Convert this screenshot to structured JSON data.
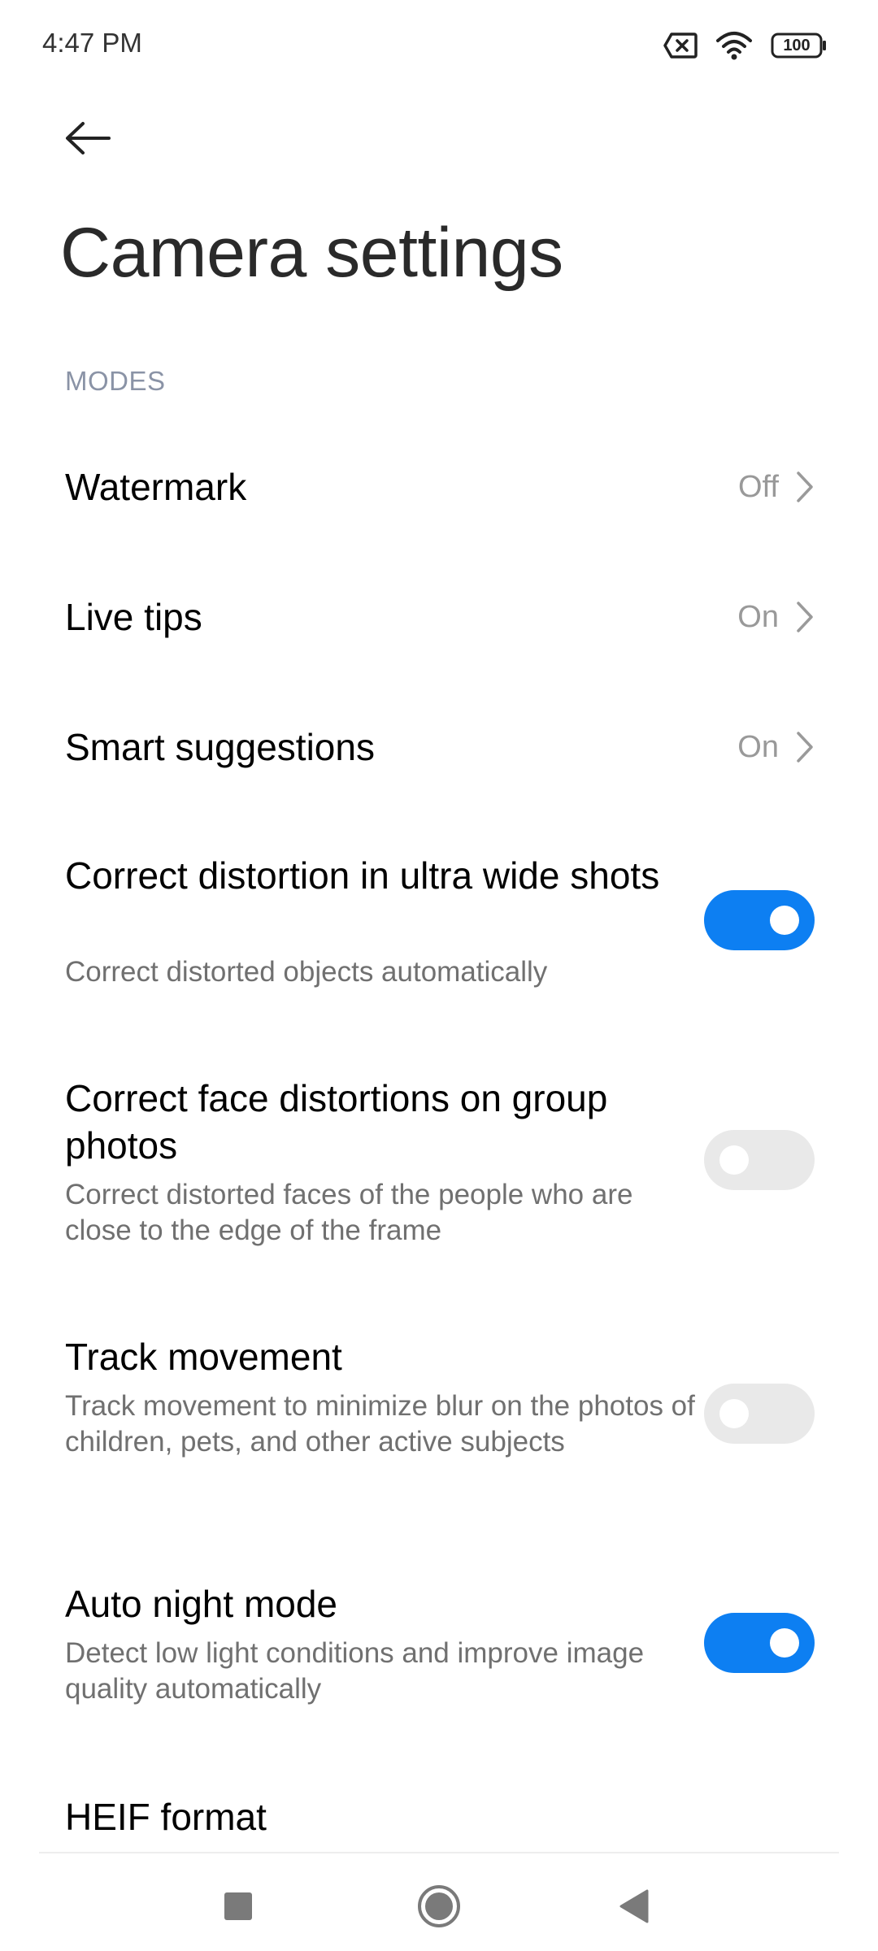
{
  "status_bar": {
    "time": "4:47 PM",
    "battery": "100"
  },
  "header": {
    "title": "Camera settings"
  },
  "section": {
    "modes": "MODES"
  },
  "nav_rows": [
    {
      "title": "Watermark",
      "value": "Off"
    },
    {
      "title": "Live tips",
      "value": "On"
    },
    {
      "title": "Smart suggestions",
      "value": "On"
    }
  ],
  "toggles": [
    {
      "title": "Correct distortion in ultra wide shots",
      "subtitle": "Correct distorted objects automatically",
      "on": true
    },
    {
      "title": "Correct face distortions on group photos",
      "subtitle": "Correct distorted faces of the people who are close to the edge of the frame",
      "on": false
    },
    {
      "title": "Track movement",
      "subtitle": "Track movement to minimize blur on the photos of children, pets, and other active subjects",
      "on": false
    },
    {
      "title": "Auto night mode",
      "subtitle": "Detect low light conditions and improve image quality automatically",
      "on": true
    }
  ],
  "partial_row": {
    "title": "HEIF format"
  },
  "colors": {
    "accent": "#0d7ff2",
    "toggle_off": "#e9e9e9",
    "section_header": "#8a93a6"
  }
}
